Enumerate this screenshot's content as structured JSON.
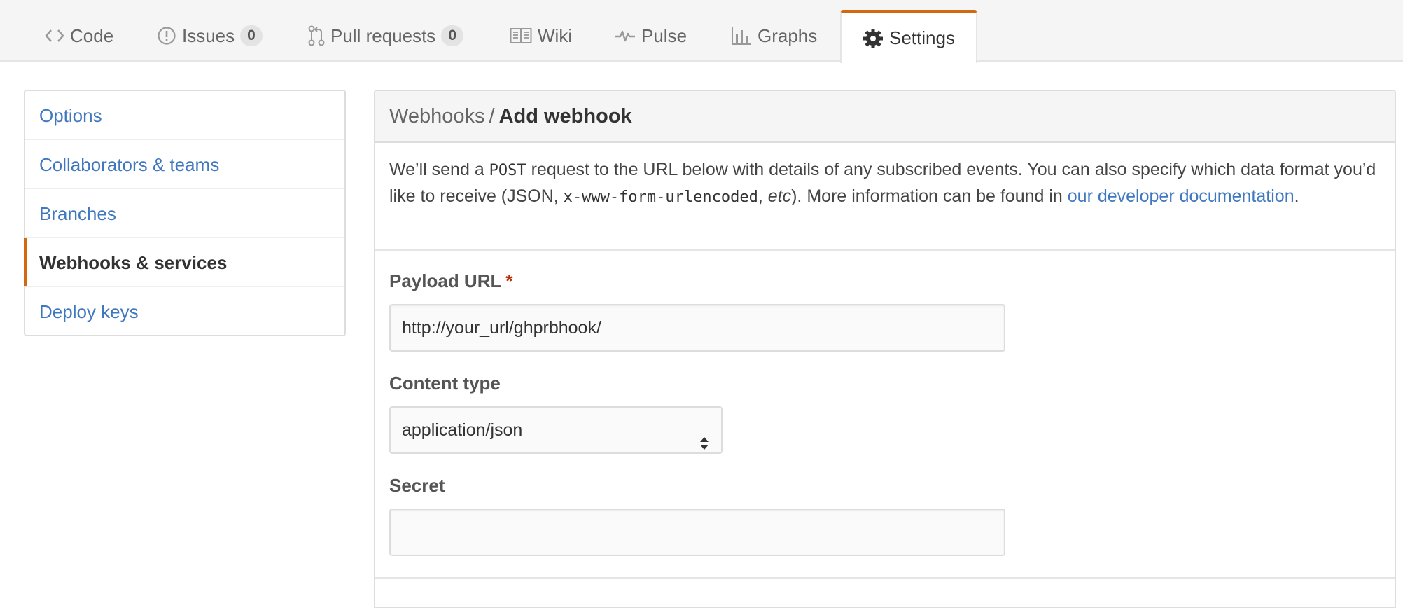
{
  "tabs": [
    {
      "label": "Code",
      "icon": "code-icon"
    },
    {
      "label": "Issues",
      "icon": "issue-opened-icon",
      "count": "0"
    },
    {
      "label": "Pull requests",
      "icon": "git-pull-request-icon",
      "count": "0"
    },
    {
      "label": "Wiki",
      "icon": "book-icon"
    },
    {
      "label": "Pulse",
      "icon": "pulse-icon"
    },
    {
      "label": "Graphs",
      "icon": "graph-icon"
    },
    {
      "label": "Settings",
      "icon": "gear-icon",
      "selected": true
    }
  ],
  "menu": {
    "items": [
      {
        "label": "Options"
      },
      {
        "label": "Collaborators & teams"
      },
      {
        "label": "Branches"
      },
      {
        "label": "Webhooks & services",
        "active": true
      },
      {
        "label": "Deploy keys"
      }
    ]
  },
  "panel": {
    "breadcrumb_parent": "Webhooks",
    "breadcrumb_sep": "/",
    "breadcrumb_current": "Add webhook",
    "intro": {
      "t1": "We’ll send a ",
      "code1": "POST",
      "t2": " request to the URL below with details of any subscribed events. You can also specify which data format you’d like to receive (JSON, ",
      "code2": "x-www-form-urlencoded",
      "t3": ", ",
      "em1": "etc",
      "t4": "). More information can be found in ",
      "link": "our developer documentation",
      "t5": "."
    },
    "payload": {
      "label": "Payload URL",
      "required_mark": "*",
      "value": "http://your_url/ghprbhook/"
    },
    "content_type": {
      "label": "Content type",
      "value": "application/json"
    },
    "secret": {
      "label": "Secret",
      "value": ""
    }
  },
  "colors": {
    "accent": "#d26911",
    "link": "#4078c0",
    "required": "#bd2c00"
  }
}
